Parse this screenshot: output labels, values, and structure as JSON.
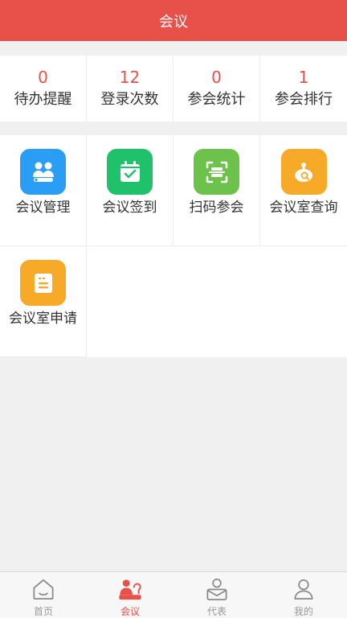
{
  "header": {
    "title": "会议"
  },
  "stats": [
    {
      "value": "0",
      "label": "待办提醒"
    },
    {
      "value": "12",
      "label": "登录次数"
    },
    {
      "value": "0",
      "label": "参会统计"
    },
    {
      "value": "1",
      "label": "参会排行"
    }
  ],
  "menu": [
    {
      "label": "会议管理",
      "icon": "people-icon",
      "color": "#2a9df4"
    },
    {
      "label": "会议签到",
      "icon": "calendar-check-icon",
      "color": "#1fc26a"
    },
    {
      "label": "扫码参会",
      "icon": "scan-icon",
      "color": "#6cc24a"
    },
    {
      "label": "会议室查询",
      "icon": "room-search-icon",
      "color": "#f7a928"
    },
    {
      "label": "会议室申请",
      "icon": "document-icon",
      "color": "#f7a928"
    }
  ],
  "tabbar": {
    "items": [
      {
        "label": "首页",
        "icon": "home-icon",
        "active": false
      },
      {
        "label": "会议",
        "icon": "meeting-icon",
        "active": true
      },
      {
        "label": "代表",
        "icon": "representative-icon",
        "active": false
      },
      {
        "label": "我的",
        "icon": "profile-icon",
        "active": false
      }
    ],
    "active_color": "#e8504a",
    "inactive_color": "#999999"
  },
  "colors": {
    "accent": "#e8504a",
    "background": "#f0f0f0"
  }
}
